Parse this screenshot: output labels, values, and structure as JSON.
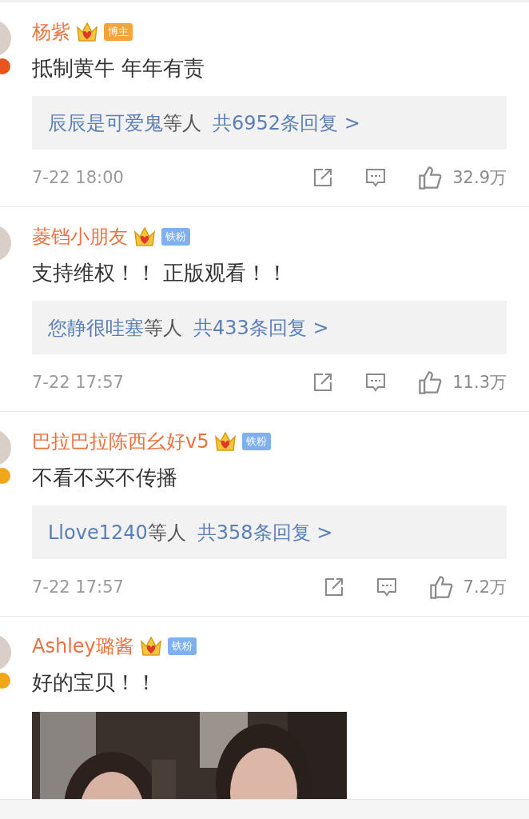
{
  "comments": [
    {
      "name": "杨紫",
      "badge": {
        "kind": "blogger",
        "label": "博主"
      },
      "verified": {
        "color": "#e8541e"
      },
      "text": "抵制黄牛 年年有责",
      "replies": {
        "names": "辰辰是可爱鬼",
        "suffix": "等人",
        "count": "共6952条回复 >"
      },
      "time": "7-22 18:00",
      "likes": "32.9万"
    },
    {
      "name": "菱铛小朋友",
      "badge": {
        "kind": "fan",
        "label": "铁粉"
      },
      "text": "支持维权！！ 正版观看！！",
      "replies": {
        "names": "您静很哇塞",
        "suffix": "等人",
        "count": "共433条回复 >"
      },
      "time": "7-22 17:57",
      "likes": "11.3万"
    },
    {
      "name": "巴拉巴拉陈西幺好v5",
      "badge": {
        "kind": "fan",
        "label": "铁粉"
      },
      "verified": {
        "color": "#f0a818"
      },
      "text": "不看不买不传播",
      "replies": {
        "names": "Llove1240",
        "suffix": "等人",
        "count": "共358条回复 >"
      },
      "time": "7-22 17:57",
      "likes": "7.2万"
    },
    {
      "name": "Ashley璐酱",
      "badge": {
        "kind": "fan",
        "label": "铁粉"
      },
      "verified": {
        "color": "#f0a818"
      },
      "text": "好的宝贝！！"
    }
  ]
}
